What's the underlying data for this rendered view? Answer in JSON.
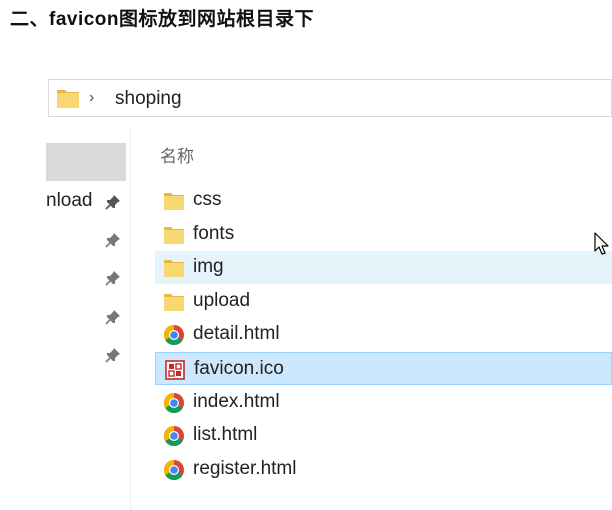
{
  "heading": "二、favicon图标放到网站根目录下",
  "address_bar": {
    "path": "shoping"
  },
  "nav_pane": {
    "partial_label": "nload"
  },
  "file_list": {
    "column_name": "名称",
    "items": [
      {
        "name": "css",
        "icon": "folder-icon",
        "state": "normal"
      },
      {
        "name": "fonts",
        "icon": "folder-icon",
        "state": "normal"
      },
      {
        "name": "img",
        "icon": "folder-icon",
        "state": "hover"
      },
      {
        "name": "upload",
        "icon": "folder-icon",
        "state": "normal"
      },
      {
        "name": "detail.html",
        "icon": "chrome-icon",
        "state": "normal"
      },
      {
        "name": "favicon.ico",
        "icon": "ico-file-icon",
        "state": "selected"
      },
      {
        "name": "index.html",
        "icon": "chrome-icon",
        "state": "normal"
      },
      {
        "name": "list.html",
        "icon": "chrome-icon",
        "state": "normal"
      },
      {
        "name": "register.html",
        "icon": "chrome-icon",
        "state": "normal"
      }
    ]
  },
  "colors": {
    "hover": "#e5f3fb",
    "selected": "#cce8ff",
    "selected_border": "#99d1ff",
    "folder": "#f8d775"
  }
}
